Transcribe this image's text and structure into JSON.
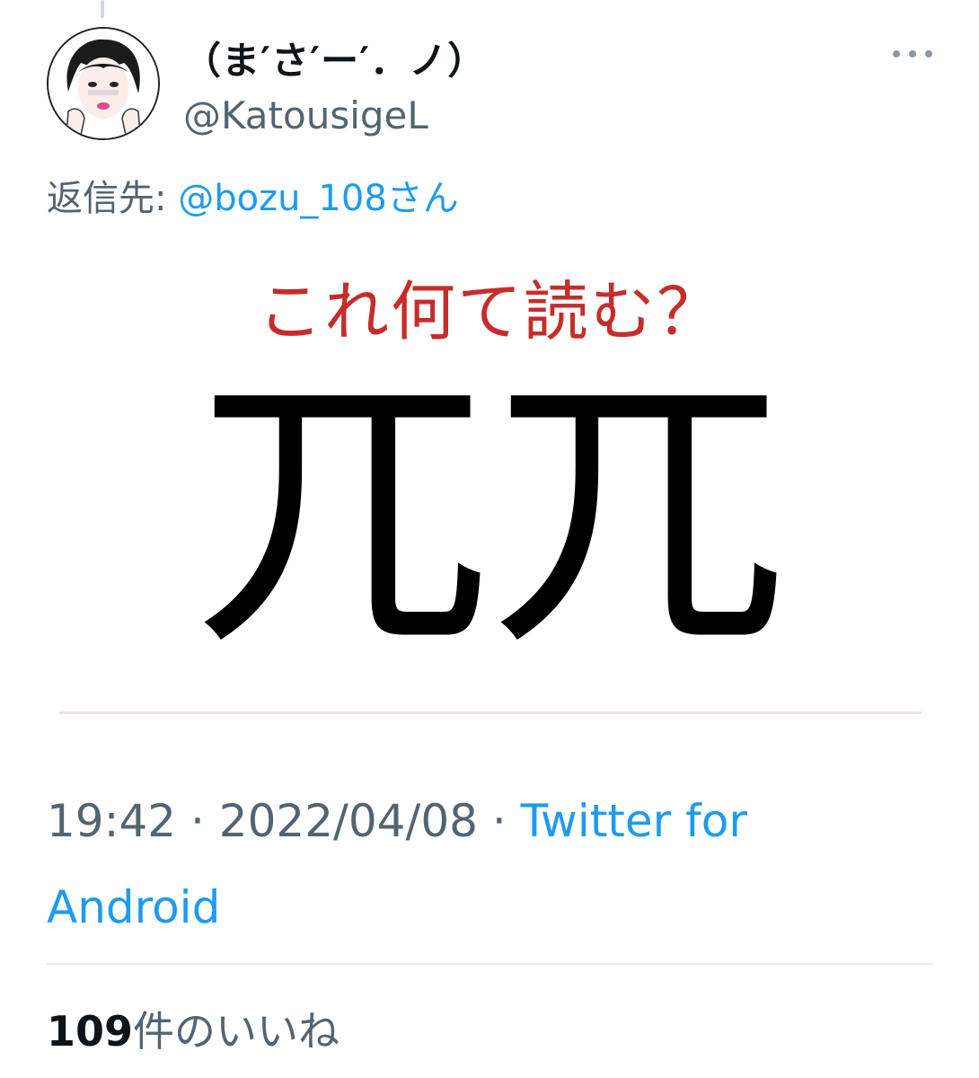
{
  "tweet": {
    "display_name": "（ま′さ′ー′．ノ）",
    "handle": "@KatousigeL",
    "reply_prefix": "返信先: ",
    "reply_mention": "@bozu_108さん",
    "image": {
      "title": "これ何て読む？",
      "characters": "兀兀"
    },
    "time": "19:42",
    "date": "2022/04/08",
    "separator": " · ",
    "source": "Twitter for Android",
    "likes_count": "109",
    "likes_label": "件のいいね"
  },
  "icons": {
    "avatar": "avatar-illustration-icon",
    "more": "more-options-icon"
  },
  "colors": {
    "link": "#1d9bf0",
    "secondary_text": "#536471",
    "image_title": "#c62d2a"
  }
}
